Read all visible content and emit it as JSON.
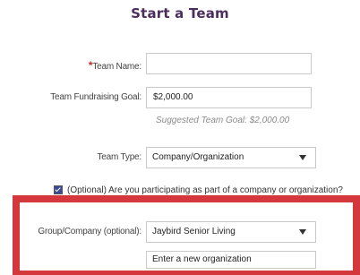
{
  "title": "Start a Team",
  "form": {
    "team_name": {
      "required_mark": "*",
      "label": "Team Name:",
      "value": ""
    },
    "fundraising_goal": {
      "label": "Team Fundraising Goal:",
      "value": "$2,000.00",
      "hint": "Suggested Team Goal: $2,000.00"
    },
    "team_type": {
      "label": "Team Type:",
      "selected": "Company/Organization"
    },
    "optional_checkbox": {
      "checked": true,
      "label": "(Optional) Are you participating as part of a company or organization?"
    },
    "group_company": {
      "label": "Group/Company (optional):",
      "selected": "Jaybird Senior Living",
      "new_org_placeholder": "Enter a new organization"
    }
  },
  "colors": {
    "title": "#4b2e5c",
    "required": "#d0202a",
    "highlight_frame": "#d5383c",
    "checkbox": "#3b4a9a"
  }
}
